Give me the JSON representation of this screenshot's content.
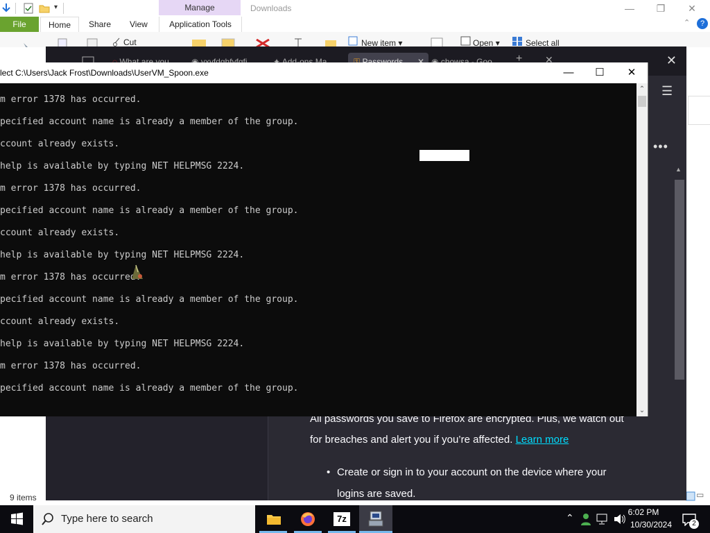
{
  "explorer": {
    "context_tab": "Manage",
    "window_title": "Downloads",
    "tabs": [
      "File",
      "Home",
      "Share",
      "View",
      "Application Tools"
    ],
    "ribbon": {
      "cut": "Cut",
      "new_item": "New item ▾",
      "open": "Open ▾",
      "select_all": "Select all"
    },
    "status": "9 items"
  },
  "firefox": {
    "tabs": [
      "What are you",
      "yxyfdghfyfgfj",
      "Add-ons Ma",
      "Passwords",
      "chowsa - Goo"
    ],
    "active_tab_index": 3,
    "content_text": "All passwords you save to Firefox are encrypted. Plus, we watch out for breaches and alert you if you’re affected.",
    "learn_more": "Learn more",
    "bullet": "Create or sign in to your account on the device where your logins are saved."
  },
  "console": {
    "title": "lect C:\\Users\\Jack Frost\\Downloads\\UserVM_Spoon.exe",
    "lines": [
      "m error 1378 has occurred.",
      "pecified account name is already a member of the group.",
      "ccount already exists.",
      "help is available by typing NET HELPMSG 2224.",
      "m error 1378 has occurred.",
      "pecified account name is already a member of the group.",
      "ccount already exists.",
      "help is available by typing NET HELPMSG 2224.",
      "m error 1378 has occurred.",
      "pecified account name is already a member of the group.",
      "ccount already exists.",
      "help is available by typing NET HELPMSG 2224.",
      "m error 1378 has occurred.",
      "pecified account name is already a member of the group."
    ]
  },
  "taskbar": {
    "search_placeholder": "Type here to search",
    "apps": [
      "file-explorer-icon",
      "firefox-icon",
      "7zip-icon",
      "uservm-spoon-icon"
    ],
    "time": "6:02 PM",
    "date": "10/30/2024",
    "notifications": "2"
  }
}
